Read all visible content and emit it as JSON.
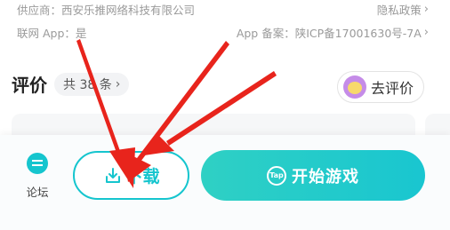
{
  "info": {
    "supplier": "供应商：西安乐推网络科技有限公司",
    "privacy": "隐私政策",
    "network": "联网 App：是",
    "app_record": "App 备案：陕ICP备17001630号-7A"
  },
  "reviews": {
    "title": "评价",
    "count_label": "共 38 条",
    "go_review": "去评价"
  },
  "bottom_bar": {
    "forum_label": "论坛",
    "download_label": "下载",
    "play_label": "开始游戏",
    "tap_icon_text": "Tap"
  },
  "colors": {
    "accent": "#15c5ce",
    "annotation_arrow": "#e8241c"
  }
}
